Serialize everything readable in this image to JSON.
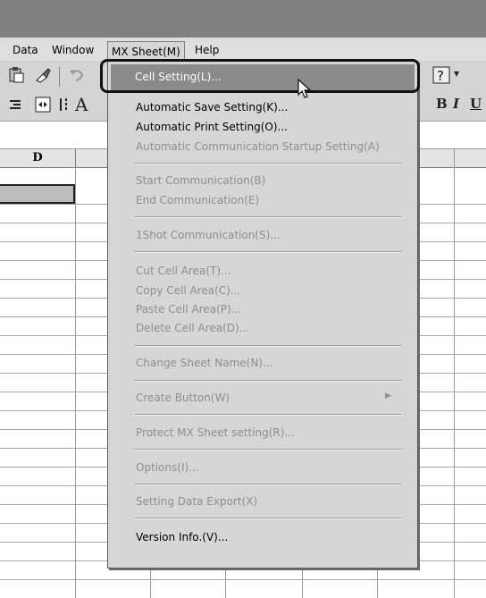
{
  "menubar": {
    "data": "Data",
    "window": "Window",
    "mx_sheet": "MX Sheet(M)",
    "help": "Help"
  },
  "toolbar": {
    "bold": "B",
    "italic": "I",
    "underline": "U",
    "font_a": "A",
    "help_glyph": "?",
    "dropdown": "▾"
  },
  "sheet": {
    "column_d": "D"
  },
  "menu": {
    "cell_setting": "Cell Setting(L)...",
    "auto_save": "Automatic Save Setting(K)...",
    "auto_print": "Automatic Print Setting(O)...",
    "auto_comm": "Automatic Communication Startup Setting(A)",
    "start_comm": "Start Communication(B)",
    "end_comm": "End Communication(E)",
    "oneshot": "1Shot Communication(S)...",
    "cut_area": "Cut Cell Area(T)...",
    "copy_area": "Copy Cell Area(C)...",
    "paste_area": "Paste Cell Area(P)...",
    "delete_area": "Delete Cell Area(D)...",
    "change_name": "Change Sheet Name(N)...",
    "create_button": "Create Button(W)",
    "protect": "Protect MX Sheet setting(R)...",
    "options": "Options(I)...",
    "export": "Setting Data Export(X)",
    "version": "Version Info.(V)..."
  },
  "colors": {
    "highlight": "#8a8a8a",
    "menu_bg": "#d6d6d6",
    "disabled_text": "#8e8e8e"
  }
}
